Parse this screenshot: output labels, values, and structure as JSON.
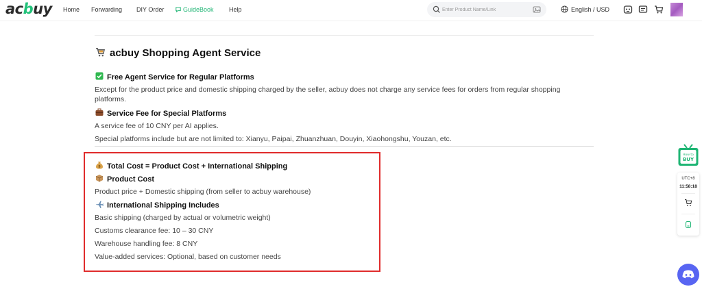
{
  "header": {
    "logo": {
      "part1": "ac",
      "part2": "b",
      "part3": "uy"
    },
    "nav": [
      {
        "label": "Home"
      },
      {
        "label": "Forwarding"
      },
      {
        "label": "DIY Order"
      },
      {
        "label": "GuideBook"
      },
      {
        "label": "Help"
      }
    ],
    "search": {
      "placeholder": "Enter Product Name/Link"
    },
    "language": "English / USD",
    "icons": [
      "scan-icon",
      "message-icon",
      "cart-icon"
    ]
  },
  "content": {
    "title": "acbuy Shopping Agent Service",
    "section1": {
      "heading": "Free Agent Service for Regular Platforms",
      "text": "Except for the product price and domestic shipping charged by the seller, acbuy does not charge any service fees for orders from regular shopping platforms."
    },
    "section2": {
      "heading": "Service Fee for Special Platforms",
      "text1": "A service fee of 10 CNY per AI applies.",
      "text2": "Special platforms include but are not limited to: Xianyu, Paipai, Zhuanzhuan, Douyin, Xiaohongshu, Youzan, etc."
    },
    "total": {
      "heading": "Total Cost = Product Cost + International Shipping",
      "product_heading": "Product Cost",
      "product_text": "Product price + Domestic shipping (from seller to acbuy warehouse)",
      "intl_heading": "International Shipping Includes",
      "lines": [
        "Basic shipping (charged by actual or volumetric weight)",
        "Customs clearance fee: 10 – 30 CNY",
        "Warehouse handling fee: 8 CNY",
        "Value-added services: Optional, based on customer needs"
      ]
    }
  },
  "widget": {
    "tv_top": "How to",
    "tv_bottom": "BUY",
    "timezone": "UTC+8",
    "time": "11:58:18"
  },
  "colors": {
    "accent": "#1fb574",
    "highlight_border": "#e02b2b",
    "discord": "#5865f2"
  }
}
